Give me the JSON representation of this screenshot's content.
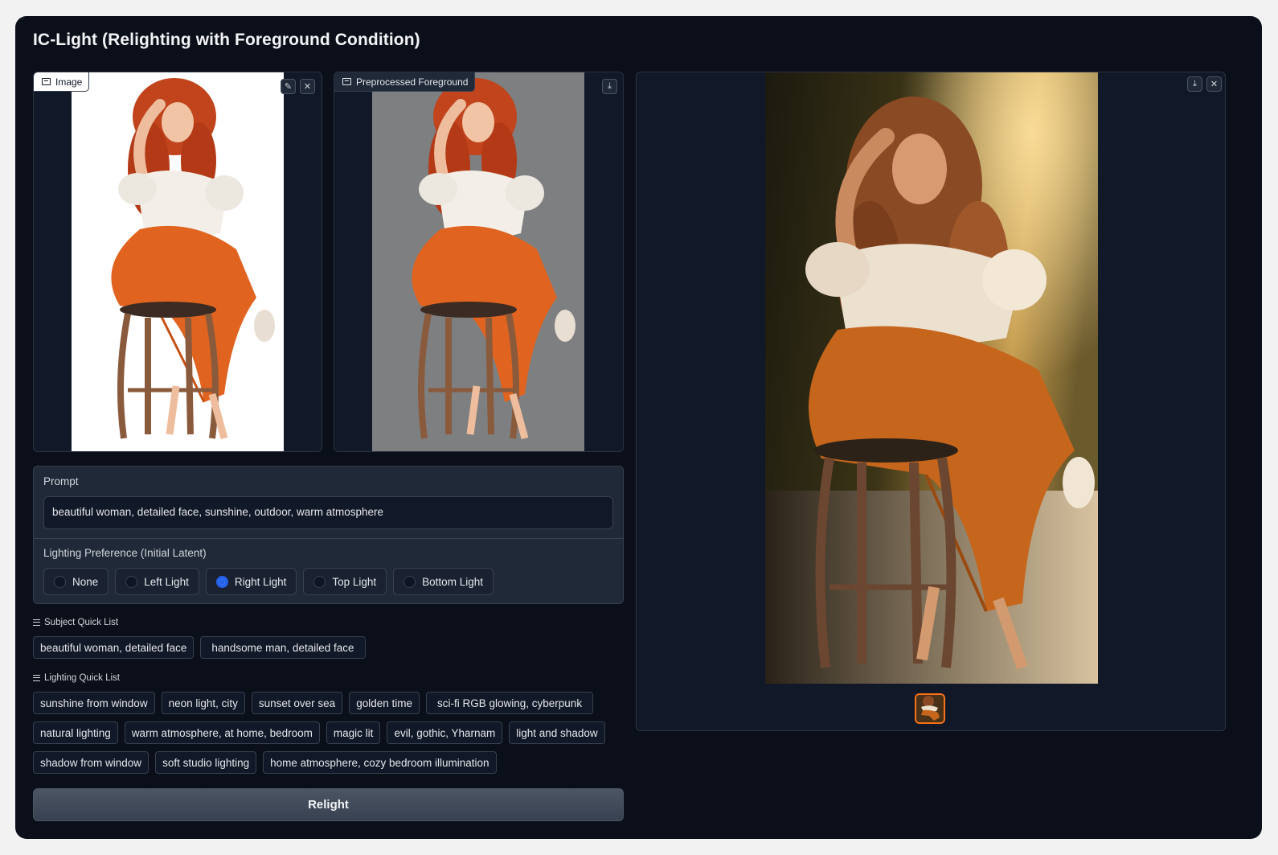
{
  "app": {
    "title": "IC-Light (Relighting with Foreground Condition)"
  },
  "input_image": {
    "label": "Image",
    "edit_icon": "pencil-icon",
    "close_icon": "close-icon"
  },
  "preprocessed": {
    "label": "Preprocessed Foreground",
    "download_icon": "download-icon"
  },
  "output": {
    "download_icon": "download-icon",
    "close_icon": "close-icon"
  },
  "prompt": {
    "label": "Prompt",
    "value": "beautiful woman, detailed face, sunshine, outdoor, warm atmosphere"
  },
  "lighting": {
    "label": "Lighting Preference (Initial Latent)",
    "options": [
      "None",
      "Left Light",
      "Right Light",
      "Top Light",
      "Bottom Light"
    ],
    "selected": "Right Light"
  },
  "subject_quick_list": {
    "title": "Subject Quick List",
    "items": [
      "beautiful woman, detailed face",
      "handsome man, detailed face"
    ]
  },
  "lighting_quick_list": {
    "title": "Lighting Quick List",
    "rows": [
      [
        "sunshine from window",
        "neon light, city",
        "sunset over sea",
        "golden time",
        "sci-fi RGB glowing, cyberpunk"
      ],
      [
        "natural lighting",
        "warm atmosphere, at home, bedroom",
        "magic lit",
        "evil, gothic, Yharnam",
        "light and shadow"
      ],
      [
        "shadow from window",
        "soft studio lighting",
        "home atmosphere, cozy bedroom illumination"
      ]
    ]
  },
  "relight_button": {
    "label": "Relight"
  },
  "colors": {
    "background": "#0b0f19",
    "panel": "#1f2937",
    "accent": "#2563eb",
    "thumb_border": "#f97316"
  }
}
